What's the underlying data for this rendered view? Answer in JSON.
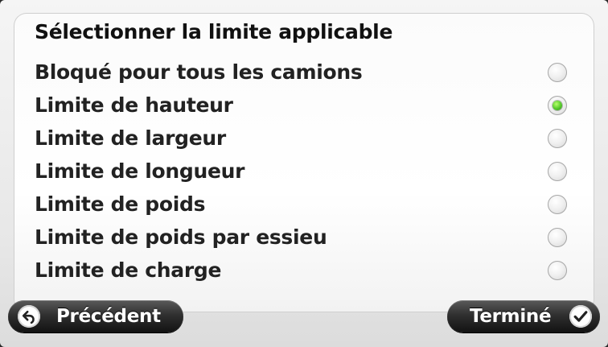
{
  "dialog": {
    "title": "Sélectionner la limite applicable"
  },
  "options": [
    {
      "label": "Bloqué pour tous les camions",
      "selected": false
    },
    {
      "label": "Limite de hauteur",
      "selected": true
    },
    {
      "label": "Limite de largeur",
      "selected": false
    },
    {
      "label": "Limite de longueur",
      "selected": false
    },
    {
      "label": "Limite de poids",
      "selected": false
    },
    {
      "label": "Limite de poids par essieu",
      "selected": false
    },
    {
      "label": "Limite de charge",
      "selected": false
    }
  ],
  "buttons": {
    "back": {
      "label": "Précédent",
      "icon": "back-arrow-icon"
    },
    "done": {
      "label": "Terminé",
      "icon": "checkmark-icon"
    }
  },
  "colors": {
    "selected_radio": "#55c82a",
    "button_background": "#303030"
  }
}
